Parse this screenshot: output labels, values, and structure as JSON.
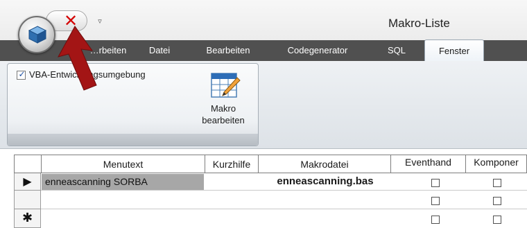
{
  "window": {
    "title": "Makro-Liste"
  },
  "quick_access": {
    "icons": [
      "close-x-icon",
      "customize-dropdown-icon"
    ],
    "dropdown_glyph": "▿"
  },
  "tabs": [
    {
      "label": "…rbeiten",
      "active": false
    },
    {
      "label": "Datei",
      "active": false
    },
    {
      "label": "Bearbeiten",
      "active": false
    },
    {
      "label": "Codegenerator",
      "active": false
    },
    {
      "label": "SQL",
      "active": false
    },
    {
      "label": "Fenster",
      "active": true
    }
  ],
  "ribbon": {
    "vba_checkbox": {
      "label": "VBA-Entwicklungsumgebung",
      "checked": true
    },
    "makro_button": {
      "line1": "Makro",
      "line2": "bearbeiten"
    }
  },
  "grid": {
    "columns": [
      "Menutext",
      "Kurzhilfe",
      "Makrodatei",
      "Eventhand",
      "Komponer"
    ],
    "rows": [
      {
        "indicator": "▶",
        "menutext": "enneascanning SORBA",
        "kurzhilfe": "",
        "makrodatei": "enneascanning.bas",
        "eventhand": false,
        "komponenten": false
      },
      {
        "indicator": "",
        "menutext": "",
        "kurzhilfe": "",
        "makrodatei": "",
        "eventhand": false,
        "komponenten": false
      },
      {
        "indicator": "✱",
        "menutext": "",
        "kurzhilfe": "",
        "makrodatei": "",
        "eventhand": false,
        "komponenten": false
      }
    ]
  },
  "colors": {
    "tabbar": "#505050",
    "accent_arrow": "#a31515",
    "close_x": "#d40000",
    "selected_cell": "#a7a7a7"
  }
}
